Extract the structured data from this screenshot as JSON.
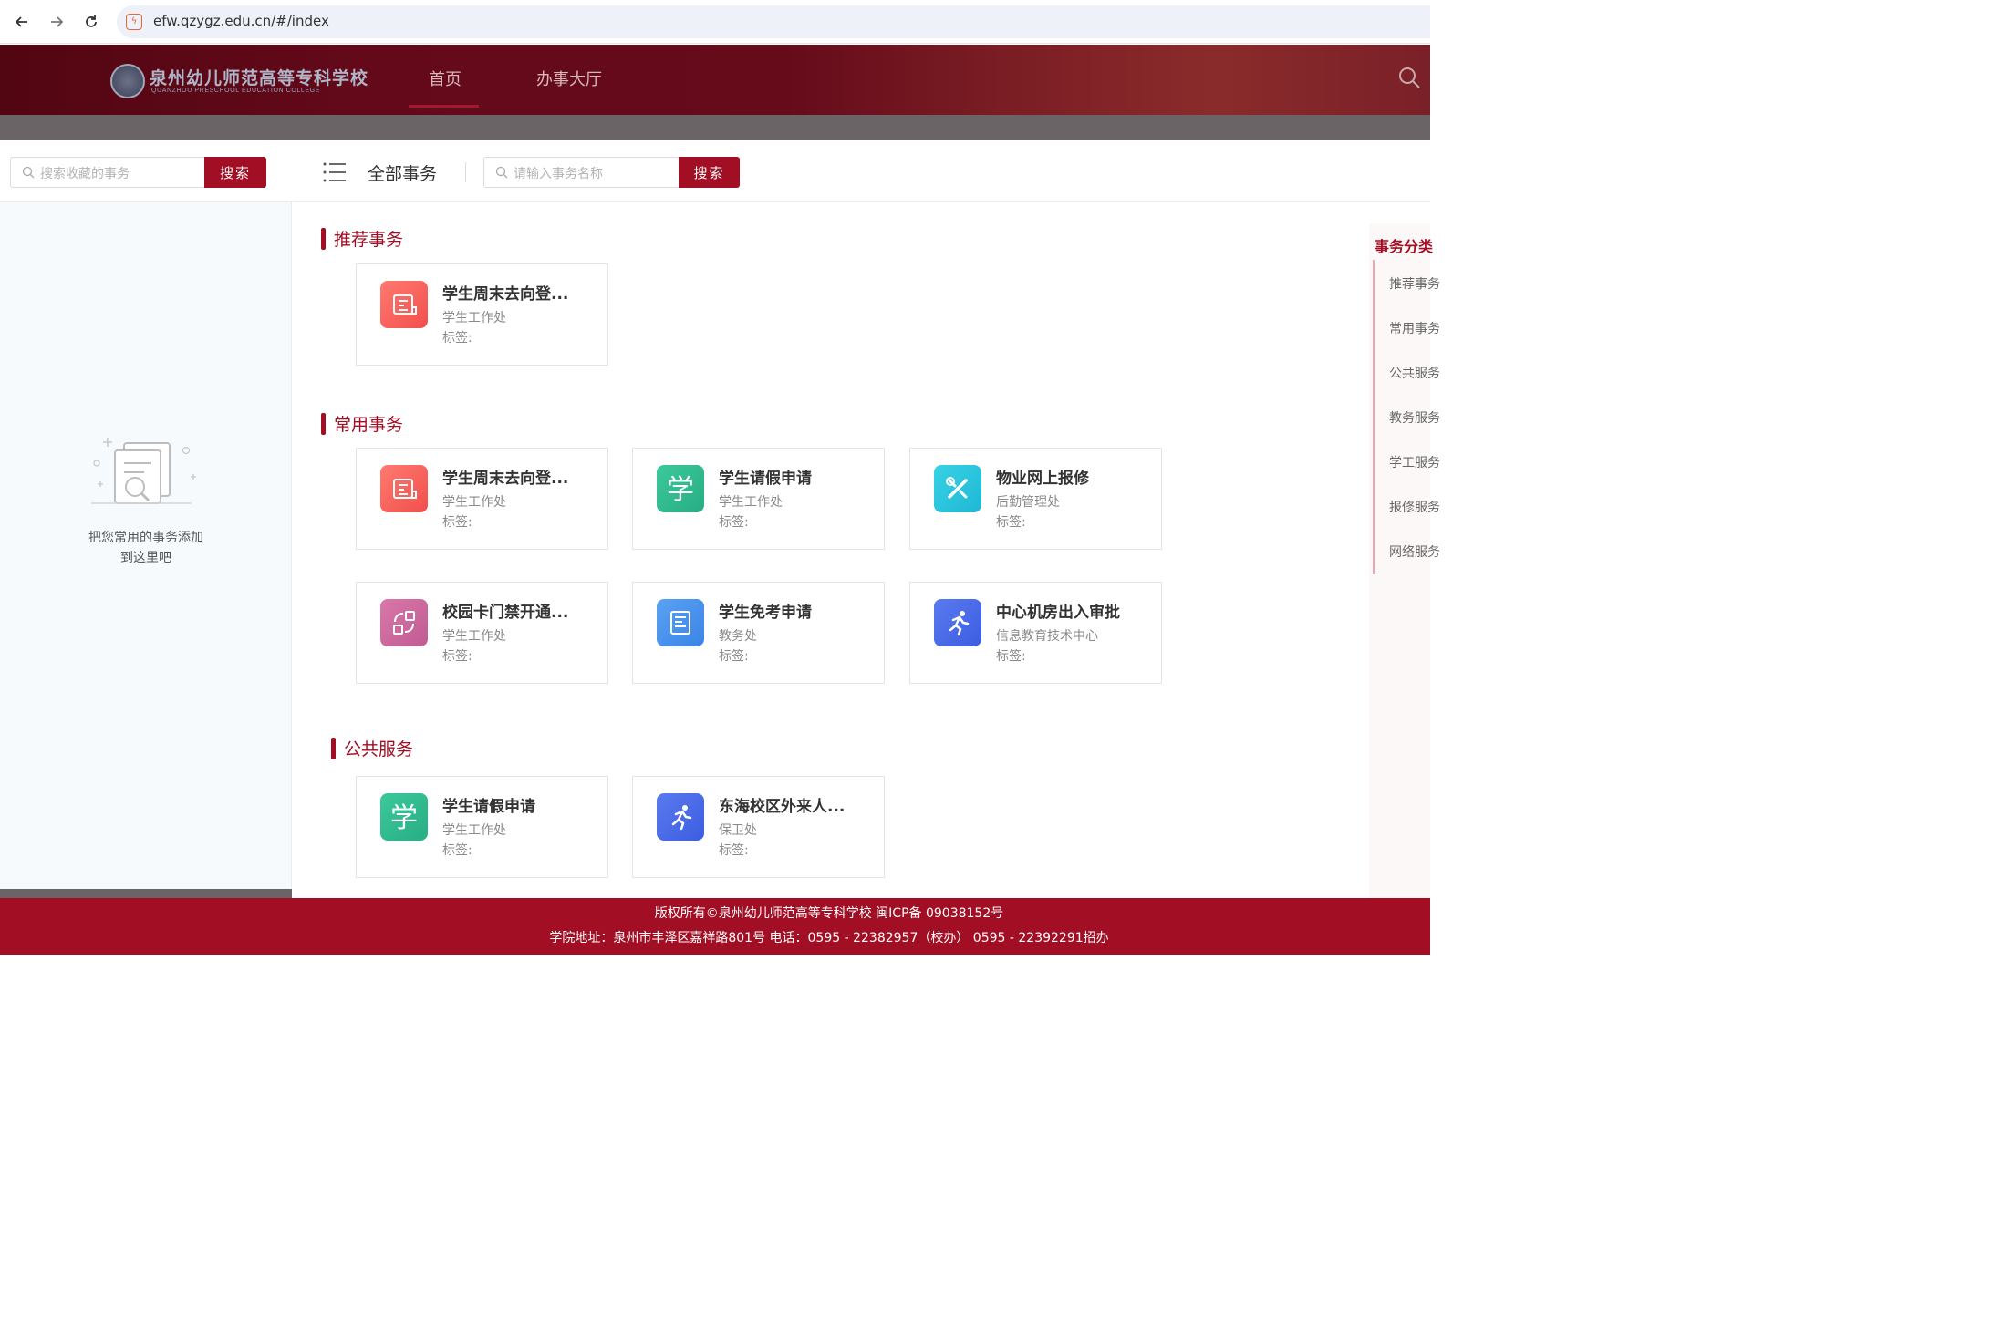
{
  "browser": {
    "url": "efw.qzygz.edu.cn/#/index",
    "icon_color": "#e8663d"
  },
  "header": {
    "logo_cn": "泉州幼儿师范高等专科学校",
    "logo_en": "QUANZHOU PRESCHOOL EDUCATION COLLEGE",
    "nav": [
      {
        "label": "首页",
        "active": true
      },
      {
        "label": "办事大厅",
        "active": false
      }
    ]
  },
  "left_panel": {
    "search_placeholder": "搜索收藏的事务",
    "search_button": "搜索",
    "empty_text_line1": "把您常用的事务添加",
    "empty_text_line2": "到这里吧"
  },
  "main": {
    "all_label": "全部事务",
    "search_placeholder": "请输入事务名称",
    "search_button": "搜索",
    "tag_label": "标签:",
    "sections": [
      {
        "title": "推荐事务",
        "cards": [
          {
            "title": "学生周末去向登...",
            "dept": "学生工作处",
            "icon": "scroll-icon",
            "color": "#f24f4c"
          }
        ]
      },
      {
        "title": "常用事务",
        "cards": [
          {
            "title": "学生周末去向登...",
            "dept": "学生工作处",
            "icon": "scroll-icon",
            "color": "#f24f4c"
          },
          {
            "title": "学生请假申请",
            "dept": "学生工作处",
            "icon": "xue-character-icon",
            "color": "#28ad84"
          },
          {
            "title": "物业网上报修",
            "dept": "后勤管理处",
            "icon": "wrench-pencil-icon",
            "color": "#1fb8d4"
          },
          {
            "title": "校园卡门禁开通...",
            "dept": "学生工作处",
            "icon": "swap-arrows-icon",
            "color": "#c05b93"
          },
          {
            "title": "学生免考申请",
            "dept": "教务处",
            "icon": "document-icon",
            "color": "#3b84e6"
          },
          {
            "title": "中心机房出入审批",
            "dept": "信息教育技术中心",
            "icon": "running-person-icon",
            "color": "#3c5de0"
          }
        ]
      },
      {
        "title": "公共服务",
        "cards": [
          {
            "title": "学生请假申请",
            "dept": "学生工作处",
            "icon": "xue-character-icon",
            "color": "#28ad84"
          },
          {
            "title": "东海校区外来人...",
            "dept": "保卫处",
            "icon": "running-person-icon",
            "color": "#3c5de0"
          }
        ]
      }
    ]
  },
  "categories": {
    "title": "事务分类",
    "items": [
      "推荐事务",
      "常用事务",
      "公共服务",
      "教务服务",
      "学工服务",
      "报修服务",
      "网络服务"
    ]
  },
  "footer": {
    "line1": "版权所有©泉州幼儿师范高等专科学校 闽ICP备 09038152号",
    "line2": "学院地址：泉州市丰泽区嘉祥路801号 电话：0595 - 22382957（校办） 0595 - 22392291招办"
  },
  "colors": {
    "brand": "#a20e24",
    "header_dark": "#520611"
  }
}
